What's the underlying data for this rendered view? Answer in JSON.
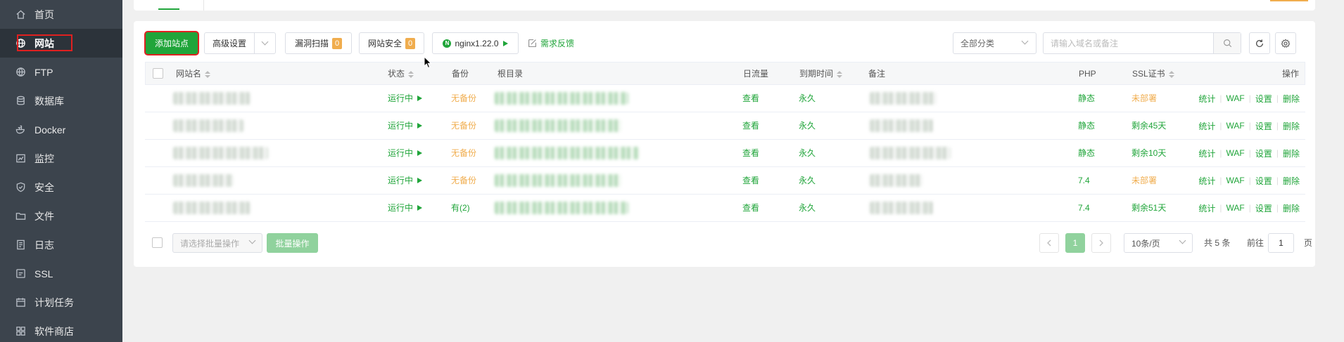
{
  "sidebar": {
    "items": [
      {
        "label": "首页",
        "icon": "home-icon"
      },
      {
        "label": "网站",
        "icon": "globe-icon"
      },
      {
        "label": "FTP",
        "icon": "ftp-icon"
      },
      {
        "label": "数据库",
        "icon": "database-icon"
      },
      {
        "label": "Docker",
        "icon": "docker-icon"
      },
      {
        "label": "监控",
        "icon": "monitor-icon"
      },
      {
        "label": "安全",
        "icon": "shield-icon"
      },
      {
        "label": "文件",
        "icon": "folder-icon"
      },
      {
        "label": "日志",
        "icon": "log-icon"
      },
      {
        "label": "SSL",
        "icon": "ssl-icon"
      },
      {
        "label": "计划任务",
        "icon": "calendar-icon"
      },
      {
        "label": "软件商店",
        "icon": "store-icon"
      }
    ],
    "active_index": 1
  },
  "toolbar": {
    "add_site": "添加站点",
    "advanced": "高级设置",
    "vuln_scan": "漏洞扫描",
    "vuln_count": "0",
    "site_security": "网站安全",
    "security_count": "0",
    "nginx_version": "nginx1.22.0",
    "feedback": "需求反馈",
    "category": "全部分类",
    "search_placeholder": "请输入域名或备注"
  },
  "table": {
    "headers": {
      "name": "网站名",
      "status": "状态",
      "backup": "备份",
      "root": "根目录",
      "traffic": "日流量",
      "expire": "到期时间",
      "remark": "备注",
      "php": "PHP",
      "ssl": "SSL证书",
      "ops": "操作"
    },
    "rows": [
      {
        "status": "运行中",
        "backup": "无备份",
        "traffic": "查看",
        "expire": "永久",
        "php": "静态",
        "ssl": "未部署"
      },
      {
        "status": "运行中",
        "backup": "无备份",
        "traffic": "查看",
        "expire": "永久",
        "php": "静态",
        "ssl": "剩余45天"
      },
      {
        "status": "运行中",
        "backup": "无备份",
        "traffic": "查看",
        "expire": "永久",
        "php": "静态",
        "ssl": "剩余10天"
      },
      {
        "status": "运行中",
        "backup": "无备份",
        "traffic": "查看",
        "expire": "永久",
        "php": "7.4",
        "ssl": "未部署"
      },
      {
        "status": "运行中",
        "backup": "有(2)",
        "traffic": "查看",
        "expire": "永久",
        "php": "7.4",
        "ssl": "剩余51天"
      }
    ],
    "ops": {
      "stats": "统计",
      "waf": "WAF",
      "settings": "设置",
      "delete": "删除"
    }
  },
  "footer": {
    "batch_placeholder": "请选择批量操作",
    "batch_button": "批量操作",
    "current_page": "1",
    "page_size": "10条/页",
    "total": "共 5 条",
    "goto_prefix": "前往",
    "goto_value": "1",
    "goto_suffix": "页"
  },
  "colors": {
    "accent": "#20a53a",
    "warning": "#f0ad4e",
    "sidebar": "#3c444d"
  }
}
